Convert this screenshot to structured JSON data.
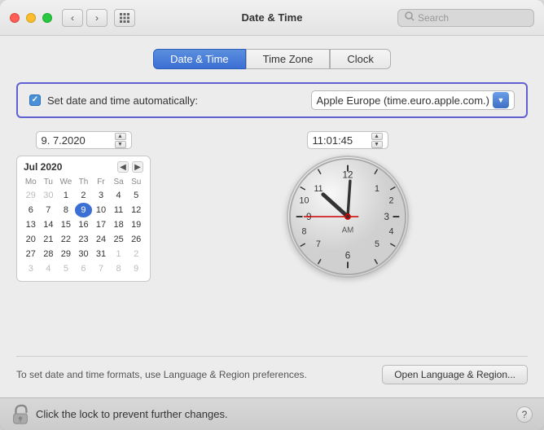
{
  "titlebar": {
    "title": "Date & Time",
    "search_placeholder": "Search"
  },
  "tabs": [
    {
      "id": "date-time",
      "label": "Date & Time",
      "active": true
    },
    {
      "id": "time-zone",
      "label": "Time Zone",
      "active": false
    },
    {
      "id": "clock",
      "label": "Clock",
      "active": false
    }
  ],
  "auto_row": {
    "label": "Set date and time automatically:",
    "checked": true,
    "server": "Apple Europe (time.euro.apple.com.)"
  },
  "date_field": {
    "value": "9. 7.2020"
  },
  "time_field": {
    "value": "11:01:45"
  },
  "calendar": {
    "month_year": "Jul 2020",
    "day_headers": [
      "Mo",
      "Tu",
      "We",
      "Th",
      "Fr",
      "Sa",
      "Su"
    ],
    "weeks": [
      [
        "29",
        "30",
        "1",
        "2",
        "3",
        "4",
        "5"
      ],
      [
        "6",
        "7",
        "8",
        "9",
        "10",
        "11",
        "12"
      ],
      [
        "13",
        "14",
        "15",
        "16",
        "17",
        "18",
        "19"
      ],
      [
        "20",
        "21",
        "22",
        "23",
        "24",
        "25",
        "26"
      ],
      [
        "27",
        "28",
        "29",
        "30",
        "31",
        "1",
        "2"
      ],
      [
        "3",
        "4",
        "5",
        "6",
        "7",
        "8",
        "9"
      ]
    ],
    "selected_day": "9",
    "selected_week": 1,
    "selected_col": 3,
    "other_month_cols_w0": [
      0,
      1
    ],
    "other_month_cols_w4": [
      5,
      6
    ],
    "other_month_cols_w5": [
      0,
      1,
      2,
      3,
      4,
      5,
      6
    ]
  },
  "clock": {
    "hour": 11,
    "minute": 1,
    "second": 45,
    "am_pm": "AM"
  },
  "bottom": {
    "text": "To set date and time formats, use Language & Region preferences.",
    "button": "Open Language & Region..."
  },
  "footer": {
    "lock_text": "Click the lock to prevent further changes."
  },
  "icons": {
    "back": "‹",
    "forward": "›",
    "grid": "⋯",
    "search": "🔍",
    "cal_prev": "◀",
    "cal_next": "▶",
    "dropdown": "▼",
    "question": "?",
    "stepper_up": "▲",
    "stepper_down": "▼"
  }
}
